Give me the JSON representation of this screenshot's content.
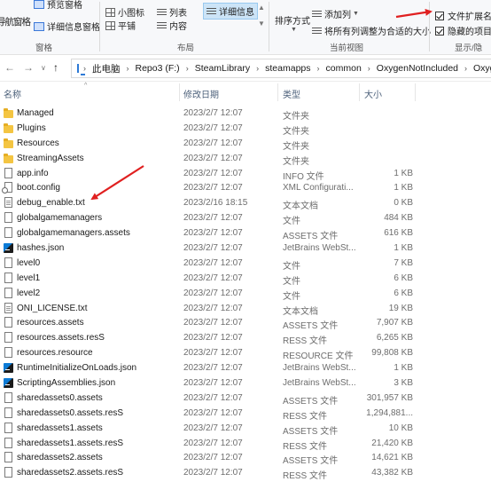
{
  "ribbon": {
    "pane_group_label": "窗格",
    "preview_pane": "预览窗格",
    "nav_pane": "导航窗格",
    "details_pane": "详细信息窗格",
    "layout_label": "布局",
    "small_icons": "小图标",
    "list": "列表",
    "details": "详细信息",
    "tiles": "平铺",
    "content": "内容",
    "current_view_label": "当前视图",
    "sort_by": "排序方式",
    "add_columns": "添加列",
    "size_all_columns": "将所有列调整为合适的大小",
    "show_hide_label": "显示/隐",
    "file_extensions": "文件扩展名",
    "hidden_items": "隐藏的项目"
  },
  "address": {
    "crumbs": [
      "此电脑",
      "Repo3 (F:)",
      "SteamLibrary",
      "steamapps",
      "common",
      "OxygenNotIncluded",
      "Oxyger"
    ]
  },
  "columns": {
    "name": "名称",
    "date": "修改日期",
    "type": "类型",
    "size": "大小"
  },
  "files": [
    {
      "name": "Managed",
      "date": "2023/2/7 12:07",
      "type": "文件夹",
      "size": "",
      "icon": "folder-icon"
    },
    {
      "name": "Plugins",
      "date": "2023/2/7 12:07",
      "type": "文件夹",
      "size": "",
      "icon": "folder-icon"
    },
    {
      "name": "Resources",
      "date": "2023/2/7 12:07",
      "type": "文件夹",
      "size": "",
      "icon": "folder-icon"
    },
    {
      "name": "StreamingAssets",
      "date": "2023/2/7 12:07",
      "type": "文件夹",
      "size": "",
      "icon": "folder-icon"
    },
    {
      "name": "app.info",
      "date": "2023/2/7 12:07",
      "type": "INFO 文件",
      "size": "1 KB",
      "icon": "file-icon"
    },
    {
      "name": "boot.config",
      "date": "2023/2/7 12:07",
      "type": "XML Configurati...",
      "size": "1 KB",
      "icon": "config-file-icon"
    },
    {
      "name": "debug_enable.txt",
      "date": "2023/2/16 18:15",
      "type": "文本文档",
      "size": "0 KB",
      "icon": "text-file-icon"
    },
    {
      "name": "globalgamemanagers",
      "date": "2023/2/7 12:07",
      "type": "文件",
      "size": "484 KB",
      "icon": "file-icon"
    },
    {
      "name": "globalgamemanagers.assets",
      "date": "2023/2/7 12:07",
      "type": "ASSETS 文件",
      "size": "616 KB",
      "icon": "file-icon"
    },
    {
      "name": "hashes.json",
      "date": "2023/2/7 12:07",
      "type": "JetBrains WebSt...",
      "size": "1 KB",
      "icon": "json-file-icon"
    },
    {
      "name": "level0",
      "date": "2023/2/7 12:07",
      "type": "文件",
      "size": "7 KB",
      "icon": "file-icon"
    },
    {
      "name": "level1",
      "date": "2023/2/7 12:07",
      "type": "文件",
      "size": "6 KB",
      "icon": "file-icon"
    },
    {
      "name": "level2",
      "date": "2023/2/7 12:07",
      "type": "文件",
      "size": "6 KB",
      "icon": "file-icon"
    },
    {
      "name": "ONI_LICENSE.txt",
      "date": "2023/2/7 12:07",
      "type": "文本文档",
      "size": "19 KB",
      "icon": "text-file-icon"
    },
    {
      "name": "resources.assets",
      "date": "2023/2/7 12:07",
      "type": "ASSETS 文件",
      "size": "7,907 KB",
      "icon": "file-icon"
    },
    {
      "name": "resources.assets.resS",
      "date": "2023/2/7 12:07",
      "type": "RESS 文件",
      "size": "6,265 KB",
      "icon": "file-icon"
    },
    {
      "name": "resources.resource",
      "date": "2023/2/7 12:07",
      "type": "RESOURCE 文件",
      "size": "99,808 KB",
      "icon": "file-icon"
    },
    {
      "name": "RuntimeInitializeOnLoads.json",
      "date": "2023/2/7 12:07",
      "type": "JetBrains WebSt...",
      "size": "1 KB",
      "icon": "json-file-icon"
    },
    {
      "name": "ScriptingAssemblies.json",
      "date": "2023/2/7 12:07",
      "type": "JetBrains WebSt...",
      "size": "3 KB",
      "icon": "json-file-icon"
    },
    {
      "name": "sharedassets0.assets",
      "date": "2023/2/7 12:07",
      "type": "ASSETS 文件",
      "size": "301,957 KB",
      "icon": "file-icon"
    },
    {
      "name": "sharedassets0.assets.resS",
      "date": "2023/2/7 12:07",
      "type": "RESS 文件",
      "size": "1,294,881...",
      "icon": "file-icon"
    },
    {
      "name": "sharedassets1.assets",
      "date": "2023/2/7 12:07",
      "type": "ASSETS 文件",
      "size": "10 KB",
      "icon": "file-icon"
    },
    {
      "name": "sharedassets1.assets.resS",
      "date": "2023/2/7 12:07",
      "type": "RESS 文件",
      "size": "21,420 KB",
      "icon": "file-icon"
    },
    {
      "name": "sharedassets2.assets",
      "date": "2023/2/7 12:07",
      "type": "ASSETS 文件",
      "size": "14,621 KB",
      "icon": "file-icon"
    },
    {
      "name": "sharedassets2.assets.resS",
      "date": "2023/2/7 12:07",
      "type": "RESS 文件",
      "size": "43,382 KB",
      "icon": "file-icon"
    }
  ],
  "colors": {
    "annotation_arrow": "#e02020",
    "folder": "#f4c542",
    "accent": "#0c7bd6"
  }
}
